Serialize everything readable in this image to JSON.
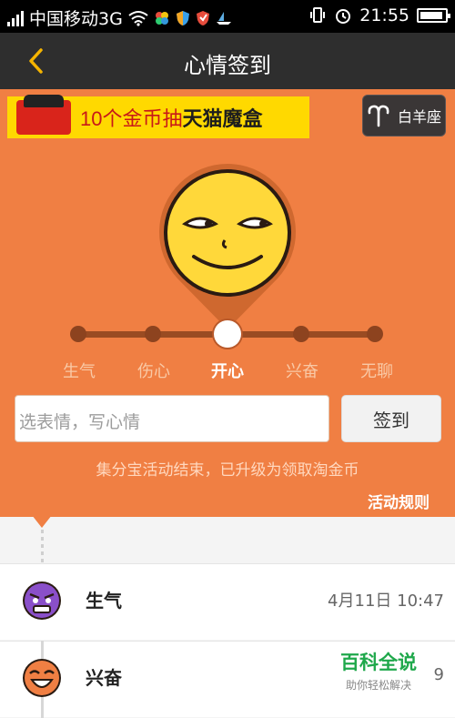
{
  "status_bar": {
    "carrier": "中国移动3G",
    "time": "21:55"
  },
  "nav": {
    "title": "心情签到",
    "back_icon": "chevron-left-icon"
  },
  "promo": {
    "text_prefix": "10个金币抽",
    "text_highlight": "天猫魔盒"
  },
  "zodiac": {
    "label": "白羊座",
    "icon": "aries-icon"
  },
  "mood_slider": {
    "moods": [
      "生气",
      "伤心",
      "开心",
      "兴奋",
      "无聊"
    ],
    "selected": "开心"
  },
  "mood_input": {
    "placeholder": "选表情，写心情"
  },
  "sign_button": "签到",
  "notice": "集分宝活动结束，已升级为领取淘金币",
  "rules_link": "活动规则",
  "history": [
    {
      "mood": "生气",
      "time": "4月11日 10:47"
    },
    {
      "mood": "兴奋",
      "time": "9"
    }
  ],
  "watermark": {
    "title": "百科全说",
    "subtitle": "助你轻松解决"
  },
  "colors": {
    "accent": "#f07f43",
    "navbar": "#2e2e2e",
    "angry_face": "#8a4fc9",
    "excited_face": "#f07f43",
    "smile_face": "#ffd83a"
  }
}
